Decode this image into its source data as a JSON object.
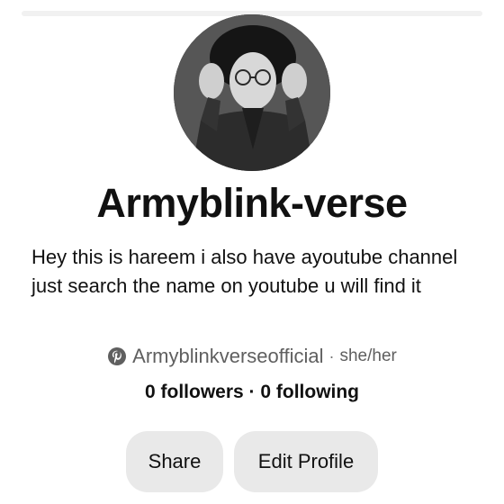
{
  "profile": {
    "display_name": "Armyblink-verse",
    "bio": "Hey this is hareem i also have ayoutube channel just search the name on youtube u will find it",
    "username": "Armyblinkverseofficial",
    "separator": "·",
    "pronouns": "she/her",
    "followers_text": "0 followers",
    "following_text": "0 following",
    "stats_separator": " · "
  },
  "actions": {
    "share_label": "Share",
    "edit_label": "Edit Profile"
  },
  "icons": {
    "platform_icon": "pinterest-logo-icon"
  },
  "colors": {
    "button_bg": "#e9e9e9",
    "muted_text": "#5f5f5f",
    "primary_text": "#111111"
  }
}
